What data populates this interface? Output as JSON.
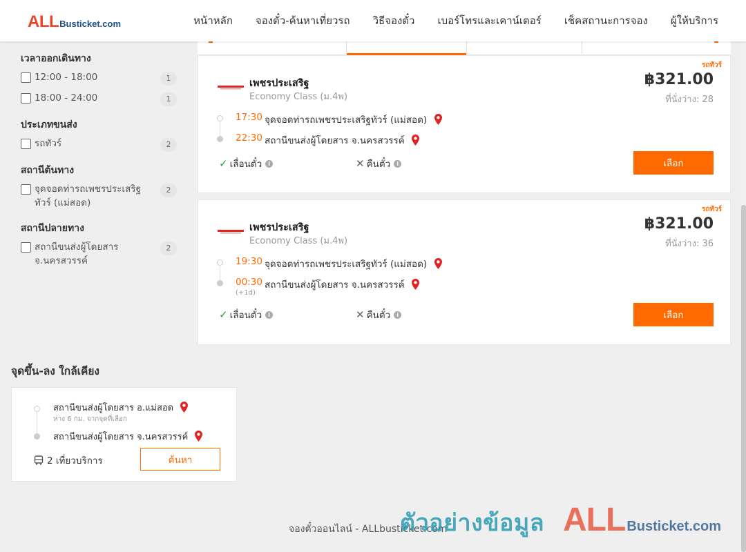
{
  "header": {
    "logo_all": "ALL",
    "logo_bus": "Busticket.com",
    "nav": [
      "หน้าหลัก",
      "จองตั๋ว-ค้นหาเที่ยวรถ",
      "วิธีจองตั๋ว",
      "เบอร์โทรและเคาน์เตอร์",
      "เช็คสถานะการจอง",
      "ผู้ให้บริการ"
    ]
  },
  "filters": {
    "time_title": "เวลาออกเดินทาง",
    "time_options": [
      {
        "label": "12:00 - 18:00",
        "count": "1"
      },
      {
        "label": "18:00 - 24:00",
        "count": "1"
      }
    ],
    "type_title": "ประเภทขนส่ง",
    "type_options": [
      {
        "label": "รถทัวร์",
        "count": "2"
      }
    ],
    "origin_title": "สถานีต้นทาง",
    "origin_options": [
      {
        "label": "จุดจอดท่ารถเพชรประเสริฐทัวร์ (แม่สอด)",
        "count": "2"
      }
    ],
    "dest_title": "สถานีปลายทาง",
    "dest_options": [
      {
        "label": "สถานีขนส่งผู้โดยสาร จ.นครสวรรค์",
        "count": "2"
      }
    ]
  },
  "trips": [
    {
      "tag": "รถทัวร์",
      "operator": "เพชรประเสริฐ",
      "class": "Economy Class (ม.4พ)",
      "price": "฿321.00",
      "seats": "ที่นั่งว่าง: 28",
      "dep_time": "17:30",
      "dep_stop": "จุดจอดท่ารถเพชรประเสริฐทัวร์ (แม่สอด)",
      "arr_time": "22:30",
      "arr_stop": "สถานีขนส่งผู้โดยสาร จ.นครสวรรค์",
      "plus": "",
      "reschedule": "เลื่อนตั๋ว",
      "refund": "คืนตั๋ว",
      "select": "เลือก"
    },
    {
      "tag": "รถทัวร์",
      "operator": "เพชรประเสริฐ",
      "class": "Economy Class (ม.4พ)",
      "price": "฿321.00",
      "seats": "ที่นั่งว่าง: 36",
      "dep_time": "19:30",
      "dep_stop": "จุดจอดท่ารถเพชรประเสริฐทัวร์ (แม่สอด)",
      "arr_time": "00:30",
      "arr_stop": "สถานีขนส่งผู้โดยสาร จ.นครสวรรค์",
      "plus": "(+1d)",
      "reschedule": "เลื่อนตั๋ว",
      "refund": "คืนตั๋ว",
      "select": "เลือก"
    }
  ],
  "nearby": {
    "title": "จุดขึ้น-ลง ใกล้เคียง",
    "from": "สถานีขนส่งผู้โดยสาร อ.แม่สอด",
    "distance": "ห่าง 6 กม. จากจุดที่เลือก",
    "to": "สถานีขนส่งผู้โดยสาร จ.นครสวรรค์",
    "trips": "2 เที่ยวบริการ",
    "search": "ค้นหา"
  },
  "footer": "จองตั๋วออนไลน์ - ALLbusticket.com",
  "watermark": {
    "text": "ตัวอย่างข้อมูล",
    "all": "ALL",
    "bus": "Busticket.com"
  },
  "colors": {
    "accent": "#ff6a00",
    "logo_red": "#e8462a",
    "logo_blue": "#1d4e86",
    "ok_green": "#2a9d3a",
    "pin_red": "#e02424"
  }
}
